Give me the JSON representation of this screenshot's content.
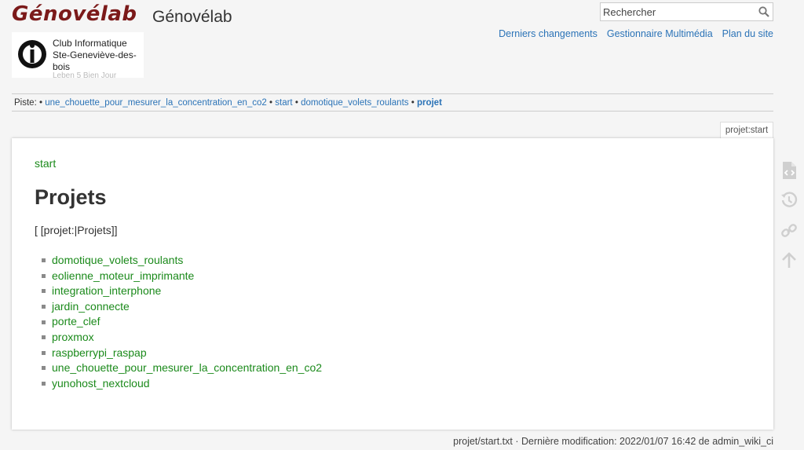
{
  "header": {
    "logo_text": "Génovélab",
    "site_title": "Génovélab",
    "club_name": "Club Informatique Ste-Geneviève-des-bois",
    "club_tagline": "Leben 5 Bien Jour"
  },
  "search": {
    "placeholder": "Rechercher"
  },
  "tools": {
    "recent_changes": "Derniers changements",
    "media_manager": "Gestionnaire Multimédia",
    "sitemap": "Plan du site"
  },
  "breadcrumbs": {
    "label": "Piste:",
    "items": [
      "une_chouette_pour_mesurer_la_concentration_en_co2",
      "start",
      "domotique_volets_roulants"
    ],
    "current": "projet"
  },
  "page": {
    "id": "projet:start",
    "crumb": "start",
    "heading": "Projets",
    "wiki_text": "[ [projet:|Projets]]",
    "items": [
      "domotique_volets_roulants",
      "eolienne_moteur_imprimante",
      "integration_interphone",
      "jardin_connecte",
      "porte_clef",
      "proxmox",
      "raspberrypi_raspap",
      "une_chouette_pour_mesurer_la_concentration_en_co2",
      "yunohost_nextcloud"
    ]
  },
  "page_tools": [
    "show-source-icon",
    "old-revisions-icon",
    "backlinks-icon",
    "back-to-top-icon"
  ],
  "doc_info": "projet/start.txt · Dernière modification: 2022/01/07 16:42 de admin_wiki_ci",
  "colors": {
    "link": "#2b73b7",
    "wikilink": "#1b8a1b",
    "logo": "#7b1a1a"
  }
}
